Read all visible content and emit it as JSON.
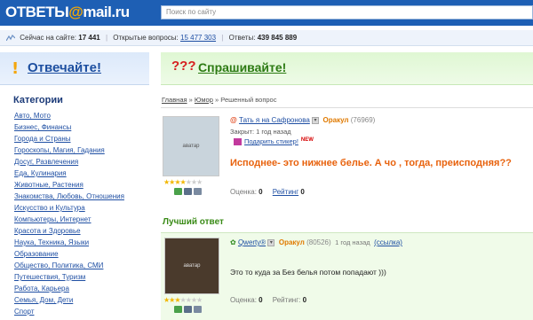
{
  "header": {
    "logo_main": "ОТВЕТЫ",
    "logo_at": "@",
    "logo_domain": "mail.ru",
    "search_placeholder": "Поиск по сайту"
  },
  "stats": {
    "online_label": "Сейчас на сайте:",
    "online_value": "17 441",
    "open_label": "Открытые вопросы:",
    "open_value": "15 477 303",
    "answers_label": "Ответы:",
    "answers_value": "439 845 889"
  },
  "left": {
    "answer_banner": "Отвечайте!",
    "categories_title": "Категории",
    "categories": [
      "Авто, Мото",
      "Бизнес, Финансы",
      "Города и Страны",
      "Гороскопы, Магия, Гадания",
      "Досуг, Развлечения",
      "Еда, Кулинария",
      "Животные, Растения",
      "Знакомства, Любовь, Отношения",
      "Искусство и Культура",
      "Компьютеры, Интернет",
      "Красота и Здоровье",
      "Наука, Техника, Языки",
      "Образование",
      "Общество, Политика, СМИ",
      "Путешествия, Туризм",
      "Работа, Карьера",
      "Семья, Дом, Дети",
      "Спорт"
    ]
  },
  "right": {
    "ask_banner": "Спрашивайте!",
    "ask_marks": "???",
    "breadcrumb": {
      "home": "Главная",
      "sep": "»",
      "category": "Юмор",
      "current": "Решенный вопрос"
    },
    "question": {
      "author": "Тать я на Сафронова",
      "rank": "Оракул",
      "points": "(76969)",
      "closed": "Закрыт: 1 год назад",
      "gift": "Подарить стикер!",
      "gift_badge": "NEW",
      "text": "Исподнее- это нижнее белье. А чо , тогда, преисподняя??",
      "stars_on": 4,
      "stars_total": 5,
      "rating_label": "Оценка:",
      "rating_value": "0",
      "top_label": "Рейтинг",
      "top_value": "0",
      "avatar_label": "аватар"
    },
    "best": {
      "title": "Лучший ответ",
      "author": "Qwerty®",
      "rank": "Оракул",
      "points": "(80526)",
      "time": "1 год назад",
      "link": "(ссылка)",
      "text": "Это то куда за Без белья потом попадают )))",
      "stars_on": 3,
      "stars_total": 5,
      "rating_label": "Оценка:",
      "rating_value": "0",
      "top_label": "Рейтинг:",
      "top_value": "0",
      "avatar_label": "аватар"
    }
  }
}
